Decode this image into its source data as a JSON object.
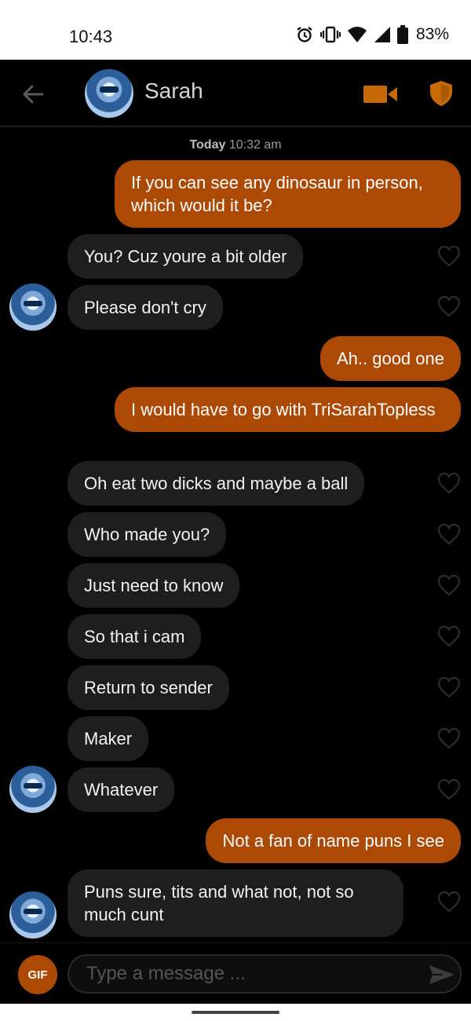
{
  "status_bar": {
    "time": "10:43",
    "battery": "83%"
  },
  "header": {
    "contact_name": "Sarah"
  },
  "chat": {
    "timestamp_day": "Today",
    "timestamp_time": "10:32 am",
    "messages": [
      {
        "dir": "out",
        "text": "If you can see any dinosaur in person, which would it be?"
      },
      {
        "dir": "in",
        "text": "You? Cuz youre a bit older"
      },
      {
        "dir": "in",
        "text": "Please don't cry"
      },
      {
        "dir": "out",
        "text": "Ah.. good one"
      },
      {
        "dir": "out",
        "text": "I would have to go with TriSarahTopless"
      },
      {
        "dir": "in",
        "text": "Oh eat two dicks and maybe a ball"
      },
      {
        "dir": "in",
        "text": "Who made you?"
      },
      {
        "dir": "in",
        "text": "Just need to know"
      },
      {
        "dir": "in",
        "text": "So that i cam"
      },
      {
        "dir": "in",
        "text": "Return to sender"
      },
      {
        "dir": "in",
        "text": "Maker"
      },
      {
        "dir": "in",
        "text": "Whatever"
      },
      {
        "dir": "out",
        "text": "Not a fan of name puns I see"
      },
      {
        "dir": "in",
        "text": "Puns sure, tits and what not, not so much cunt"
      }
    ]
  },
  "composer": {
    "gif_label": "GIF",
    "placeholder": "Type a message ..."
  },
  "colors": {
    "accent": "#ac4904",
    "incoming_bubble": "#1e1e1e",
    "background": "#000000"
  },
  "icons": [
    "back-arrow-icon",
    "video-call-icon",
    "shield-icon",
    "heart-icon",
    "send-icon",
    "alarm-icon",
    "vibrate-icon",
    "wifi-icon",
    "signal-icon",
    "battery-icon"
  ]
}
